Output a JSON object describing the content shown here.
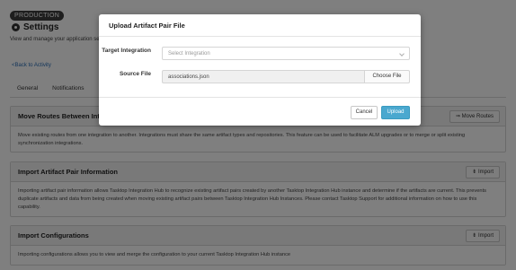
{
  "env_badge": "PRODUCTION",
  "page": {
    "title": "Settings",
    "subtitle": "View and manage your application settings",
    "back_link": "<Back to Activity",
    "tabs": [
      "General",
      "Notifications"
    ]
  },
  "sections": {
    "move_routes": {
      "title": "Move Routes Between Integrations",
      "button": "⇒ Move Routes",
      "body": "Move existing routes from one integration to another. Integrations must share the same artifact types and repositories. This feature can be used to facilitate ALM upgrades or to merge or split existing synchronization integrations."
    },
    "import_pairs": {
      "title": "Import Artifact Pair Information",
      "button": "⇟ Import",
      "body": "Importing artifact pair information allows Tasktop Integration Hub to recognize existing artifact pairs created by another Tasktop Integration Hub instance and determine if the artifacts are current. This prevents duplicate artifacts and data from being created when moving existing artifact pairs between Tasktop Integration Hub Instances. Please contact Tasktop Support for additional information on how to use this capability."
    },
    "import_config": {
      "title": "Import Configurations",
      "button": "⇟ Import",
      "body": "Importing configurations allows you to view and merge the configuration to your current Tasktop Integration Hub instance"
    }
  },
  "modal": {
    "title": "Upload Artifact Pair File",
    "target_label": "Target Integration",
    "target_placeholder": "Select Integration",
    "source_label": "Source File",
    "source_value": "associations.json",
    "choose_file": "Choose File",
    "cancel": "Cancel",
    "upload": "Upload"
  },
  "colors": {
    "accent": "#4aa8cf",
    "link": "#2a6db5",
    "overlay": "rgba(0,0,0,0.5)"
  }
}
